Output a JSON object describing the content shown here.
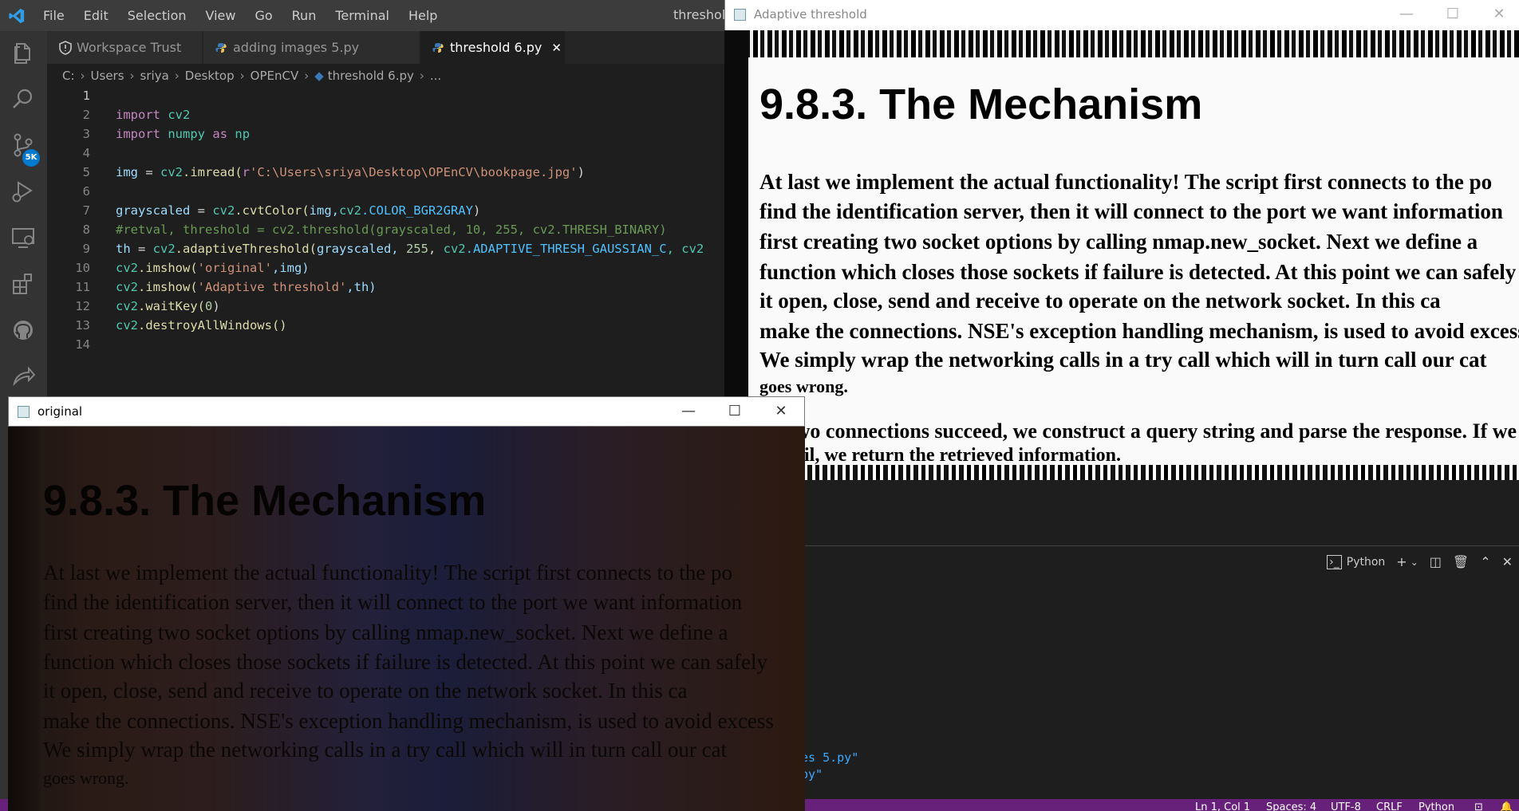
{
  "vscode": {
    "menu": [
      "File",
      "Edit",
      "Selection",
      "View",
      "Go",
      "Run",
      "Terminal",
      "Help"
    ],
    "title_partial": "threshold",
    "source_control_badge": "5K",
    "tabs": [
      {
        "label": "Workspace Trust",
        "icon": "shield-icon"
      },
      {
        "label": "adding images 5.py",
        "icon": "python-icon"
      },
      {
        "label": "threshold 6.py",
        "icon": "python-icon",
        "active": true,
        "close": "✕"
      }
    ],
    "breadcrumb": [
      "C:",
      "Users",
      "sriya",
      "Desktop",
      "OPEnCV",
      "threshold 6.py",
      "..."
    ],
    "line_numbers": [
      "1",
      "2",
      "3",
      "4",
      "5",
      "6",
      "7",
      "8",
      "9",
      "10",
      "11",
      "12",
      "13",
      "14"
    ],
    "code": {
      "l1_import": "import",
      "l1_mod": "cv2",
      "l2_import": "import",
      "l2_mod": "numpy",
      "l2_as": "as",
      "l2_alias": "np",
      "l4_var": "img",
      "l4_eq": " = ",
      "l4_obj": "cv2",
      "l4_fn": ".imread(",
      "l4_prefix": "r",
      "l4_str": "'C:\\Users\\sriya\\Desktop\\OPEnCV\\bookpage.jpg'",
      "l4_close": ")",
      "l6_var": "grayscaled",
      "l6_eq": " = ",
      "l6_obj": "cv2",
      "l6_fn": ".cvtColor(",
      "l6_args": "img,",
      "l6_obj2": "cv2",
      "l6_const": ".COLOR_BGR2GRAY",
      "l6_close": ")",
      "l7_comment": "#retval, threshold = cv2.threshold(grayscaled, 10, 255, cv2.THRESH_BINARY)",
      "l8_var": "th",
      "l8_eq": " = ",
      "l8_obj": "cv2",
      "l8_fn": ".adaptiveThreshold(",
      "l8_arg1": "grayscaled, ",
      "l8_num": "255",
      "l8_sep": ", ",
      "l8_obj2": "cv2",
      "l8_const": ".ADAPTIVE_THRESH_GAUSSIAN_C",
      "l8_tail": ", cv2",
      "l9_obj": "cv2",
      "l9_fn": ".imshow(",
      "l9_str": "'original'",
      "l9_args": ",img)",
      "l10_obj": "cv2",
      "l10_fn": ".imshow(",
      "l10_str": "'Adaptive threshold'",
      "l10_args": ",th)",
      "l11_obj": "cv2",
      "l11_fn": ".waitKey(",
      "l11_num": "0",
      "l11_close": ")",
      "l12_obj": "cv2",
      "l12_fn": ".destroyAllWindows()"
    },
    "terminal": {
      "profile": "Python",
      "line1": "es 5.py\"",
      "line2": "py\""
    },
    "status": {
      "ln_col": "Ln 1, Col 1",
      "spaces": "Spaces: 4",
      "encoding": "UTF-8",
      "eol": "CRLF",
      "lang": "Python"
    },
    "colors": {
      "accent": "#007acc",
      "statusbar": "#68217a",
      "editor_bg": "#1e1e1e"
    }
  },
  "adaptive_window": {
    "title": "Adaptive threshold",
    "image": {
      "heading": "9.8.3. The Mechanism",
      "lines": [
        "At last we implement the actual functionality! The script first connects to the po",
        "find the identification server, then it will connect to the port we want information",
        "first creating two socket options by calling nmap.new_socket. Next we define a",
        "function which closes those sockets if failure is detected. At this point we can safely",
        "it open, close, send and receive to operate on the network socket. In this ca",
        "make the connections. NSE's exception handling mechanism, is used to avoid excess",
        "We simply wrap the networking calls in a try call which will in turn call our cat",
        "goes wrong.",
        "two connections succeed, we construct a query string and parse the response. If we",
        "fail, we return the retrieved information."
      ]
    }
  },
  "original_window": {
    "title": "original",
    "image": {
      "heading": "9.8.3. The Mechanism",
      "lines": [
        "At last we implement the actual functionality! The script first connects to the po",
        "find the identification server, then it will connect to the port we want information",
        "first creating two socket options by calling nmap.new_socket. Next we define a",
        "function which closes those sockets if failure is detected. At this point we can safely",
        "it open, close, send and receive to operate on the network socket. In this ca",
        "make the connections. NSE's exception handling mechanism, is used to avoid excess",
        "We simply wrap the networking calls in a try call which will in turn call our cat",
        "goes wrong."
      ]
    }
  },
  "window_buttons": {
    "minimize": "—",
    "maximize": "☐",
    "close": "✕"
  }
}
